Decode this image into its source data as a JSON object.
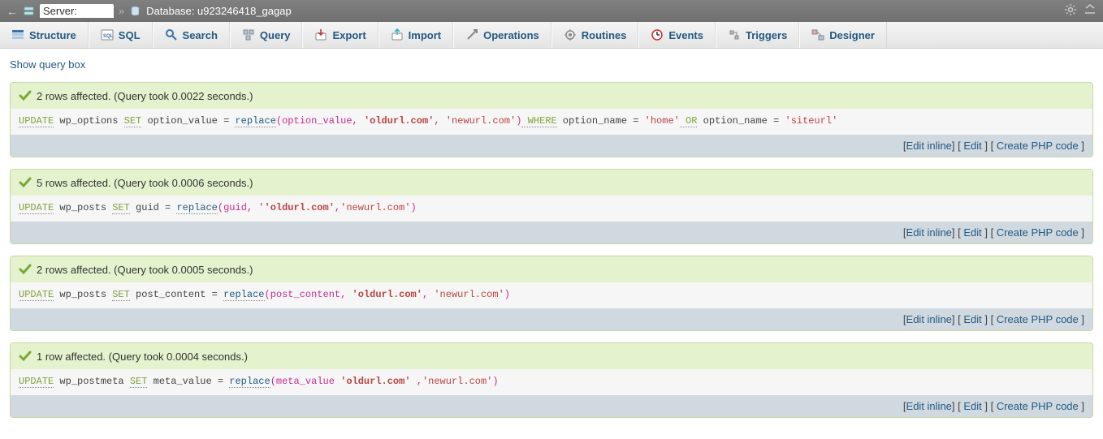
{
  "breadcrumb": {
    "server_label": "Server:",
    "server_value": "",
    "database_label": "Database:",
    "database_value": "u923246418_gagap"
  },
  "tabs": [
    {
      "label": "Structure",
      "name": "structure"
    },
    {
      "label": "SQL",
      "name": "sql"
    },
    {
      "label": "Search",
      "name": "search"
    },
    {
      "label": "Query",
      "name": "query"
    },
    {
      "label": "Export",
      "name": "export"
    },
    {
      "label": "Import",
      "name": "import"
    },
    {
      "label": "Operations",
      "name": "operations"
    },
    {
      "label": "Routines",
      "name": "routines"
    },
    {
      "label": "Events",
      "name": "events"
    },
    {
      "label": "Triggers",
      "name": "triggers"
    },
    {
      "label": "Designer",
      "name": "designer"
    }
  ],
  "show_query": "Show query box",
  "result_links": {
    "edit_inline": "Edit inline",
    "edit": "Edit",
    "create_php": "Create PHP code"
  },
  "results": [
    {
      "status": "2 rows affected. (Query took 0.0022 seconds.)",
      "sql": {
        "action": "UPDATE",
        "table": "wp_options",
        "set": "SET",
        "col_lhs": "option_value",
        "eq": " = ",
        "fn": "replace",
        "args_pre": "(option_value, ",
        "old": "'oldurl.com'",
        "comma": ", ",
        "new": "'newurl.com'",
        "args_post": ")",
        "where": " WHERE",
        "cond1": " option_name = ",
        "lit1": "'home'",
        "or": " OR",
        "cond2": " option_name = ",
        "lit2": "'siteurl'"
      }
    },
    {
      "status": "5 rows affected. (Query took 0.0006 seconds.)",
      "sql": {
        "action": "UPDATE",
        "table": "wp_posts",
        "set": "SET",
        "col_lhs": "guid",
        "eq": " = ",
        "fn": "replace",
        "args_pre": "(guid, '",
        "old": "'oldurl.com'",
        "comma": ",",
        "new": "'newurl.com'",
        "args_post": ")"
      }
    },
    {
      "status": "2 rows affected. (Query took 0.0005 seconds.)",
      "sql": {
        "action": "UPDATE",
        "table": "wp_posts",
        "set": "SET",
        "col_lhs": "post_content",
        "eq": " = ",
        "fn": "replace",
        "args_pre": "(post_content, ",
        "old": "'oldurl.com'",
        "comma": ", ",
        "new": "'newurl.com'",
        "args_post": ")"
      }
    },
    {
      "status": "1 row affected. (Query took 0.0004 seconds.)",
      "sql": {
        "action": "UPDATE",
        "table": "wp_postmeta",
        "set": "SET",
        "col_lhs": "meta_value",
        "eq": " = ",
        "fn": "replace",
        "args_pre": "(meta_value ",
        "old": "'oldurl.com'",
        "comma": " ,",
        "new": "'newurl.com'",
        "args_post": ")"
      }
    }
  ]
}
